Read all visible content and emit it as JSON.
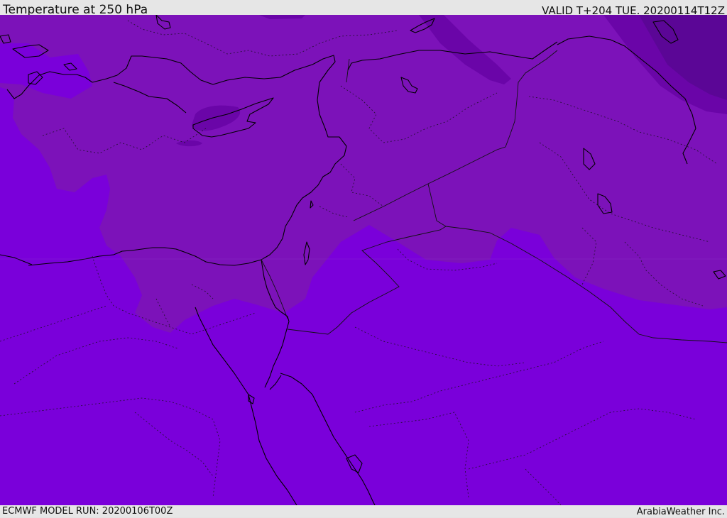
{
  "header": {
    "title": "Temperature at 250 hPa",
    "valid": "VALID T+204 TUE. 20200114T12Z"
  },
  "footer": {
    "model_run": "ECMWF MODEL RUN: 20200106T00Z",
    "credit": "ArabiaWeather Inc."
  },
  "map": {
    "colors": {
      "background_field": "#7a00da",
      "warmer_field": "#7c12b9",
      "dark_field": "#6a05a8",
      "darkest_field": "#5b0696",
      "coastline": "#000000",
      "border": "#1a0a2a"
    }
  }
}
